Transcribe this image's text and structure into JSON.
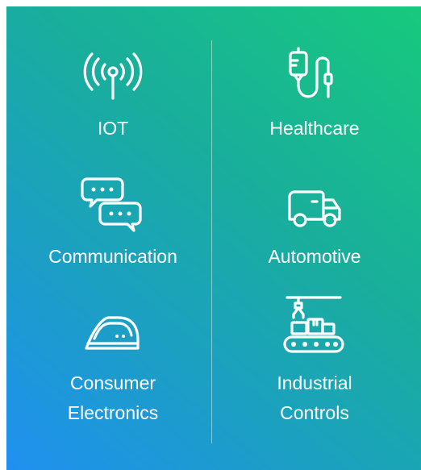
{
  "items": [
    {
      "label": "IOT",
      "icon": "antenna-signal-icon"
    },
    {
      "label": "Healthcare",
      "icon": "iv-drip-icon"
    },
    {
      "label": "Communication",
      "icon": "chat-bubbles-icon"
    },
    {
      "label": "Automotive",
      "icon": "delivery-truck-icon"
    },
    {
      "label": "Consumer",
      "label2": "Electronics",
      "icon": "clothes-iron-icon"
    },
    {
      "label": "Industrial",
      "label2": "Controls",
      "icon": "robotic-conveyor-icon"
    }
  ]
}
